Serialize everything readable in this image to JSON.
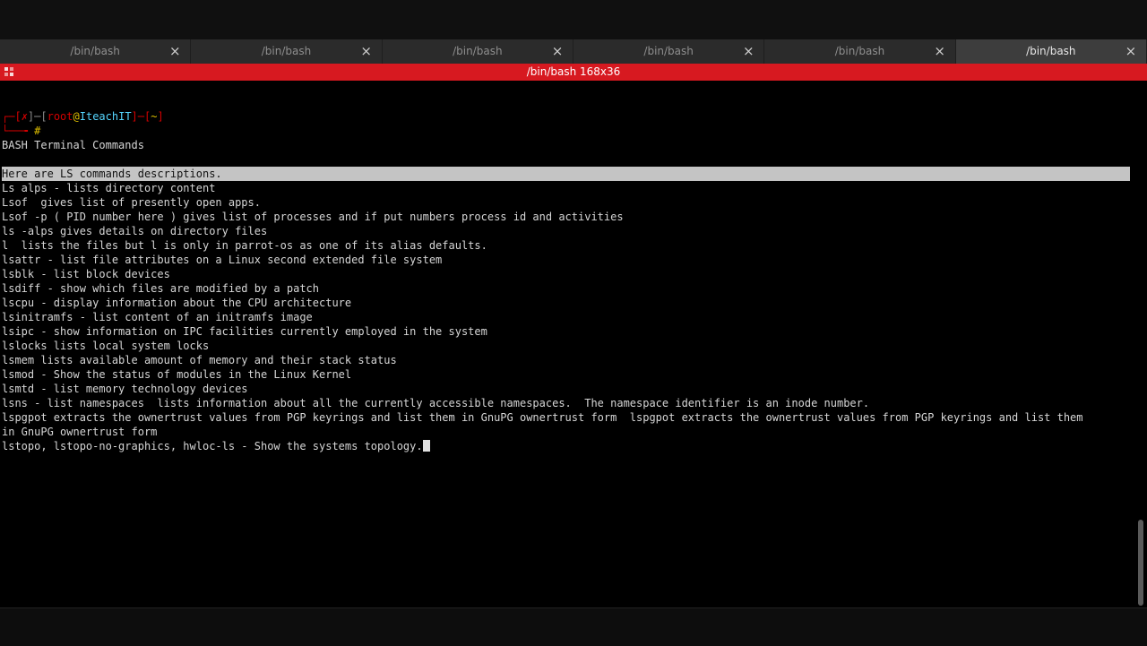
{
  "tabs": [
    {
      "label": "/bin/bash",
      "active": false
    },
    {
      "label": "/bin/bash",
      "active": false
    },
    {
      "label": "/bin/bash",
      "active": false
    },
    {
      "label": "/bin/bash",
      "active": false
    },
    {
      "label": "/bin/bash",
      "active": false
    },
    {
      "label": "/bin/bash",
      "active": true
    }
  ],
  "tab_close_glyph": "×",
  "window": {
    "title": "/bin/bash 168x36",
    "accent_color": "#d71920"
  },
  "prompt": {
    "open": "┌─[",
    "status": "✗",
    "sep1": "]─[",
    "user": "root",
    "at": "@",
    "host": "IteachIT",
    "sep2": "]─[",
    "path": "~",
    "close": "]",
    "second_line": "└──╼ ",
    "symbol": "#"
  },
  "terminal": {
    "lines": [
      "BASH Terminal Commands",
      "",
      "Here are LS commands descriptions.",
      "Ls alps - lists directory content",
      "Lsof  gives list of presently open apps.",
      "Lsof -p ( PID number here ) gives list of processes and if put numbers process id and activities",
      "ls -alps gives details on directory files",
      "l  lists the files but l is only in parrot-os as one of its alias defaults.",
      "lsattr - list file attributes on a Linux second extended file system",
      "lsblk - list block devices",
      "lsdiff - show which files are modified by a patch",
      "lscpu - display information about the CPU architecture",
      "lsinitramfs - list content of an initramfs image",
      "lsipc - show information on IPC facilities currently employed in the system",
      "lslocks lists local system locks",
      "lsmem lists available amount of memory and their stack status",
      "lsmod - Show the status of modules in the Linux Kernel",
      "lsmtd - list memory technology devices",
      "lsns - list namespaces  lists information about all the currently accessible namespaces.  The namespace identifier is an inode number.",
      "lspgpot extracts the ownertrust values from PGP keyrings and list them in GnuPG ownertrust form  lspgpot extracts the ownertrust values from PGP keyrings and list them",
      "in GnuPG ownertrust form",
      "lstopo, lstopo-no-graphics, hwloc-ls - Show the systems topology."
    ],
    "highlighted_line_index": 2
  }
}
